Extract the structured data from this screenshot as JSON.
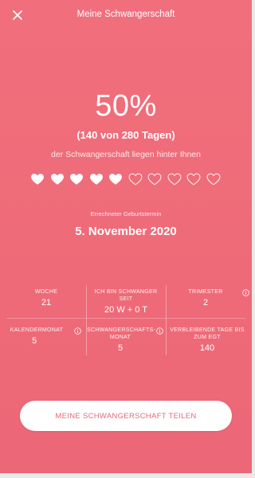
{
  "header": {
    "title": "Meine Schwangerschaft",
    "close_icon": "close-icon"
  },
  "progress": {
    "percent_label": "50%",
    "days_label": "(140 von 280 Tagen)",
    "subtitle": "der Schwangerschaft liegen hinter Ihnen",
    "hearts_total": 10,
    "hearts_filled": 5
  },
  "due": {
    "label": "Errechneter Geburtstermin",
    "date": "5. November 2020"
  },
  "stats": {
    "week": {
      "label": "WOCHE",
      "value": "21"
    },
    "pregnant_since": {
      "label": "ICH BIN SCHWANGER SEIT",
      "value": "20 W + 0 T"
    },
    "trimester": {
      "label": "TRIMESTER",
      "value": "2"
    },
    "calendar_month": {
      "label": "KALENDERMONAT",
      "value": "5"
    },
    "pregnancy_month": {
      "label": "SCHWANGERSCHAFTS-MONAT",
      "value": "5"
    },
    "remaining_days": {
      "label": "VERBLEIBENDE TAGE BIS ZUM EGT",
      "value": "140"
    }
  },
  "share_button": {
    "label": "MEINE SCHWANGERSCHAFT TEILEN"
  },
  "colors": {
    "background": "#ef6c7a",
    "accent_text": "#e8677a"
  }
}
